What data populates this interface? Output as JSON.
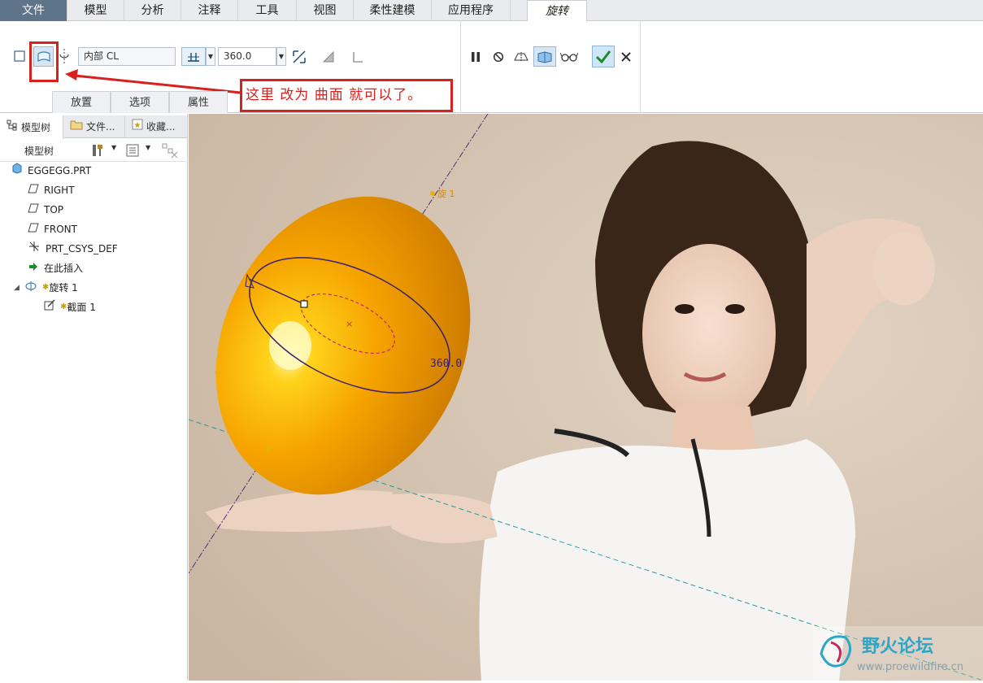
{
  "menubar": {
    "tabs": [
      {
        "label": "文件"
      },
      {
        "label": "模型"
      },
      {
        "label": "分析"
      },
      {
        "label": "注释"
      },
      {
        "label": "工具"
      },
      {
        "label": "视图"
      },
      {
        "label": "柔性建模"
      },
      {
        "label": "应用程序"
      },
      {
        "label": "旋转"
      }
    ]
  },
  "ribbon": {
    "axis_value": "内部 CL",
    "angle_value": "360.0",
    "subtabs": [
      "放置",
      "选项",
      "属性"
    ]
  },
  "annotation": {
    "note": "这里  改为  曲面  就可以了。",
    "color": "#d8201c"
  },
  "sidebar": {
    "tabs": [
      "模型树",
      "文件...",
      "收藏..."
    ],
    "toolbar_title": "模型树",
    "tree": {
      "root": "EGGEGG.PRT",
      "items": [
        "RIGHT",
        "TOP",
        "FRONT",
        "PRT_CSYS_DEF",
        "在此插入"
      ],
      "feature": "旋转 1",
      "feature_child": "截面 1"
    }
  },
  "viewport": {
    "angle_label": "360.0",
    "point_label": "旋 1",
    "egg_color": "#f6a300"
  },
  "watermark": {
    "title": "野火论坛",
    "url": "www.proewildfire.cn"
  }
}
